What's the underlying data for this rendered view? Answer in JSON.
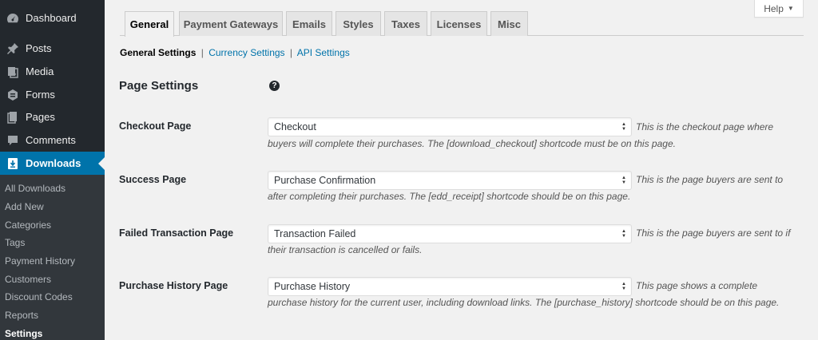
{
  "sidebar": {
    "menu": [
      {
        "label": "Dashboard",
        "icon": "dashboard-icon"
      },
      {
        "label": "Posts",
        "icon": "pin-icon"
      },
      {
        "label": "Media",
        "icon": "media-icon"
      },
      {
        "label": "Forms",
        "icon": "forms-icon"
      },
      {
        "label": "Pages",
        "icon": "pages-icon"
      },
      {
        "label": "Comments",
        "icon": "comments-icon"
      },
      {
        "label": "Downloads",
        "icon": "download-icon"
      }
    ],
    "submenu": [
      "All Downloads",
      "Add New",
      "Categories",
      "Tags",
      "Payment History",
      "Customers",
      "Discount Codes",
      "Reports",
      "Settings"
    ]
  },
  "help": {
    "label": "Help"
  },
  "tabs": [
    "General",
    "Payment Gateways",
    "Emails",
    "Styles",
    "Taxes",
    "Licenses",
    "Misc"
  ],
  "subsections": {
    "current": "General Settings",
    "links": [
      "Currency Settings",
      "API Settings"
    ],
    "separator": "|"
  },
  "section": {
    "heading": "Page Settings",
    "help_glyph": "?"
  },
  "rows": [
    {
      "label": "Checkout Page",
      "value": "Checkout",
      "description": "This is the checkout page where buyers will complete their purchases. The [download_checkout] shortcode must be on this page."
    },
    {
      "label": "Success Page",
      "value": "Purchase Confirmation",
      "description": "This is the page buyers are sent to after completing their purchases. The [edd_receipt] shortcode should be on this page."
    },
    {
      "label": "Failed Transaction Page",
      "value": "Transaction Failed",
      "description": "This is the page buyers are sent to if their transaction is cancelled or fails."
    },
    {
      "label": "Purchase History Page",
      "value": "Purchase History",
      "description": "This page shows a complete purchase history for the current user, including download links. The [purchase_history] shortcode should be on this page."
    }
  ],
  "colors": {
    "sidebar": "#23282d",
    "submenu": "#32373c",
    "accent": "#0073aa",
    "background": "#f1f1f1"
  }
}
